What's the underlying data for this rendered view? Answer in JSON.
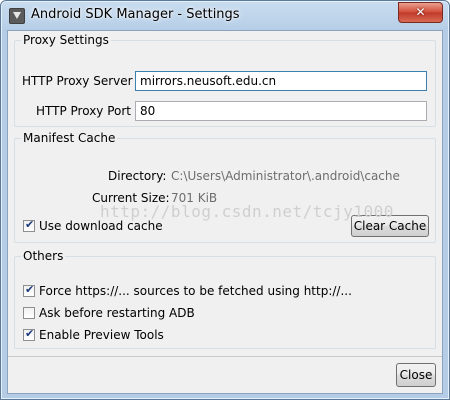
{
  "window": {
    "title": "Android SDK Manager - Settings",
    "close_glyph": "✕"
  },
  "proxy": {
    "legend": "Proxy Settings",
    "server_label": "HTTP Proxy Server",
    "server_value": "mirrors.neusoft.edu.cn",
    "port_label": "HTTP Proxy Port",
    "port_value": "80"
  },
  "manifest": {
    "legend": "Manifest Cache",
    "directory_label": "Directory:",
    "directory_value": "C:\\Users\\Administrator\\.android\\cache",
    "size_label": "Current Size:",
    "size_value": "701 KiB",
    "use_cache_label": "Use download cache",
    "use_cache_checked": true,
    "clear_button": "Clear Cache"
  },
  "others": {
    "legend": "Others",
    "options": [
      {
        "label": "Force https://... sources to be fetched using http://...",
        "checked": true
      },
      {
        "label": "Ask before restarting ADB",
        "checked": false
      },
      {
        "label": "Enable Preview Tools",
        "checked": true
      }
    ]
  },
  "footer": {
    "close_button": "Close"
  },
  "watermark": "http://blog.csdn.net/tcjy1000",
  "colors": {
    "titlebar": "#bcd3ea",
    "close_button": "#c0392b",
    "focus_border": "#3c7fb1"
  }
}
